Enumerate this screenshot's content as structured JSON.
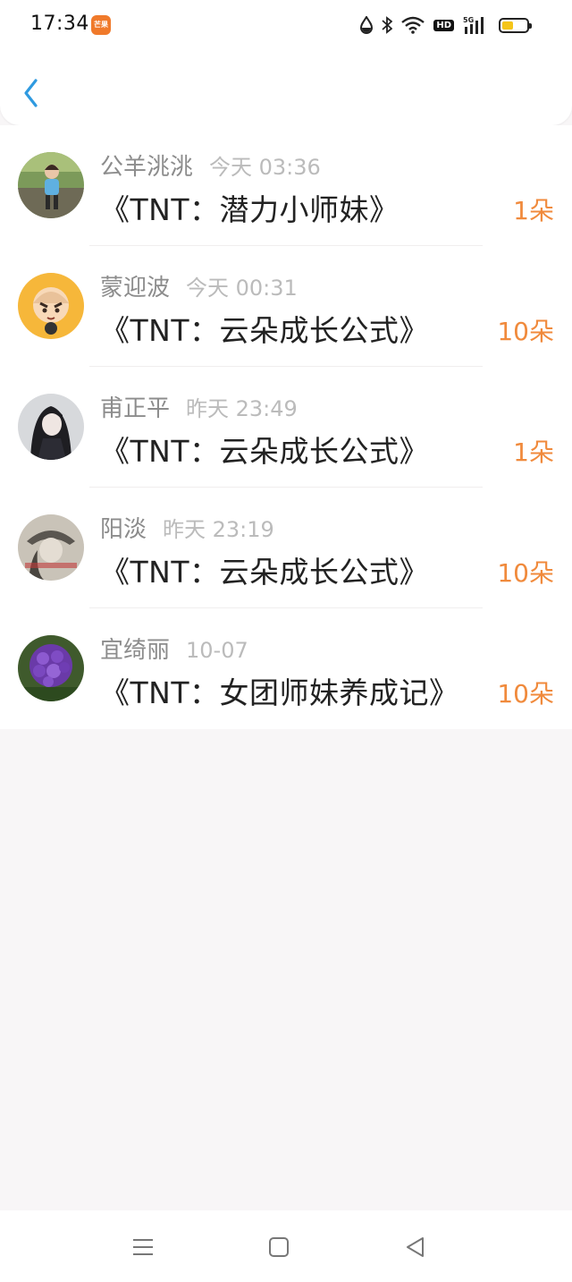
{
  "status_bar": {
    "time": "17:34",
    "app_badge": "芒果",
    "hd_label": "HD",
    "network_label": "5G",
    "battery_level": 0.45
  },
  "header": {
    "back_icon": "chevron-left-icon",
    "accent_color": "#2f9ae0"
  },
  "gifts": [
    {
      "name": "公羊洮洮",
      "time": "今天 03:36",
      "title": "《TNT：潜力小师妹》",
      "count": "1朵",
      "avatar": "child-photo"
    },
    {
      "name": "蒙迎波",
      "time": "今天 00:31",
      "title": "《TNT：云朵成长公式》",
      "count": "10朵",
      "avatar": "cartoon-monk"
    },
    {
      "name": "甫正平",
      "time": "昨天 23:49",
      "title": "《TNT：云朵成长公式》",
      "count": "1朵",
      "avatar": "anime-character"
    },
    {
      "name": "阳淡",
      "time": "昨天 23:19",
      "title": "《TNT：云朵成长公式》",
      "count": "10朵",
      "avatar": "girl-photo"
    },
    {
      "name": "宜绮丽",
      "time": "10-07",
      "title": "《TNT：女团师妹养成记》",
      "count": "10朵",
      "avatar": "purple-flower"
    }
  ],
  "colors": {
    "count": "#f08a3c",
    "name": "#8c8c8c",
    "time": "#bbbbbb",
    "title": "#222222"
  },
  "nav": {
    "menu_icon": "menu-icon",
    "home_icon": "home-icon",
    "back_icon": "back-triangle-icon"
  }
}
